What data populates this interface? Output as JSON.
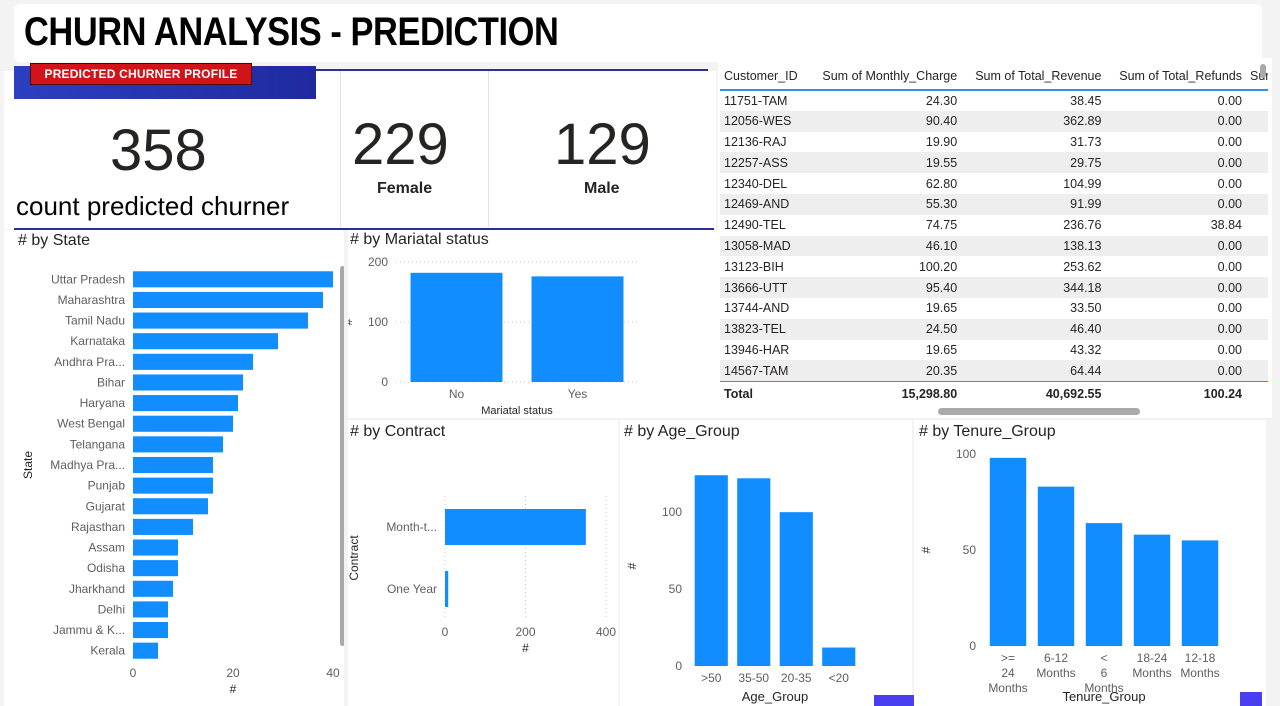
{
  "header": {
    "title": "CHURN ANALYSIS - PREDICTION",
    "badge": "PREDICTED CHURNER PROFILE"
  },
  "kpis": {
    "total": {
      "value": "358",
      "label": "count predicted churner"
    },
    "female": {
      "value": "229",
      "label": "Female"
    },
    "male": {
      "value": "129",
      "label": "Male"
    }
  },
  "table": {
    "columns": [
      "Customer_ID",
      "Sum of Monthly_Charge",
      "Sum of Total_Revenue",
      "Sum of Total_Refunds",
      "Sum"
    ],
    "rows": [
      [
        "11751-TAM",
        "24.30",
        "38.45",
        "0.00"
      ],
      [
        "12056-WES",
        "90.40",
        "362.89",
        "0.00"
      ],
      [
        "12136-RAJ",
        "19.90",
        "31.73",
        "0.00"
      ],
      [
        "12257-ASS",
        "19.55",
        "29.75",
        "0.00"
      ],
      [
        "12340-DEL",
        "62.80",
        "104.99",
        "0.00"
      ],
      [
        "12469-AND",
        "55.30",
        "91.99",
        "0.00"
      ],
      [
        "12490-TEL",
        "74.75",
        "236.76",
        "38.84"
      ],
      [
        "13058-MAD",
        "46.10",
        "138.13",
        "0.00"
      ],
      [
        "13123-BIH",
        "100.20",
        "253.62",
        "0.00"
      ],
      [
        "13666-UTT",
        "95.40",
        "344.18",
        "0.00"
      ],
      [
        "13744-AND",
        "19.65",
        "33.50",
        "0.00"
      ],
      [
        "13823-TEL",
        "24.50",
        "46.40",
        "0.00"
      ],
      [
        "13946-HAR",
        "19.65",
        "43.32",
        "0.00"
      ],
      [
        "14567-TAM",
        "20.35",
        "64.44",
        "0.00"
      ]
    ],
    "total": [
      "Total",
      "15,298.80",
      "40,692.55",
      "100.24"
    ]
  },
  "chart_data": [
    {
      "id": "state",
      "type": "bar",
      "orientation": "horizontal",
      "title": "# by State",
      "xlabel": "#",
      "ylabel": "State",
      "categories": [
        "Uttar Pradesh",
        "Maharashtra",
        "Tamil Nadu",
        "Karnataka",
        "Andhra Pra...",
        "Bihar",
        "Haryana",
        "West Bengal",
        "Telangana",
        "Madhya Pra...",
        "Punjab",
        "Gujarat",
        "Rajasthan",
        "Assam",
        "Odisha",
        "Jharkhand",
        "Delhi",
        "Jammu & K...",
        "Kerala"
      ],
      "values": [
        40,
        38,
        35,
        29,
        24,
        22,
        21,
        20,
        18,
        16,
        16,
        15,
        12,
        9,
        9,
        8,
        7,
        7,
        5
      ],
      "xlim": [
        0,
        40
      ],
      "xticks": [
        "0",
        "20",
        "40"
      ],
      "color": "#118DFF"
    },
    {
      "id": "marital",
      "type": "bar",
      "title": "# by Mariatal status",
      "xlabel": "Mariatal status",
      "ylabel": "#",
      "categories": [
        "No",
        "Yes"
      ],
      "values": [
        182,
        176
      ],
      "ylim": [
        0,
        200
      ],
      "yticks": [
        "0",
        "100",
        "200"
      ],
      "grid": true,
      "color": "#118DFF"
    },
    {
      "id": "contract",
      "type": "bar",
      "orientation": "horizontal",
      "title": "# by Contract",
      "xlabel": "#",
      "ylabel": "Contract",
      "categories": [
        "Month-t...",
        "One Year"
      ],
      "values": [
        350,
        8
      ],
      "xlim": [
        0,
        400
      ],
      "xticks": [
        "0",
        "200",
        "400"
      ],
      "grid": true,
      "color": "#118DFF"
    },
    {
      "id": "age",
      "type": "bar",
      "title": "# by Age_Group",
      "xlabel": "Age_Group",
      "ylabel": "#",
      "categories": [
        ">50",
        "35-50",
        "20-35",
        "<20"
      ],
      "values": [
        124,
        122,
        100,
        12
      ],
      "ylim": [
        0,
        130
      ],
      "yticks": [
        "0",
        "50",
        "100"
      ],
      "color": "#118DFF"
    },
    {
      "id": "tenure",
      "type": "bar",
      "title": "# by Tenure_Group",
      "xlabel": "Tenure_Group",
      "ylabel": "#",
      "categories": [
        ">= 24 Months",
        "6-12 Months",
        "< 6 Months",
        "18-24 Months",
        "12-18 Months"
      ],
      "values": [
        98,
        83,
        64,
        58,
        55
      ],
      "ylim": [
        0,
        100
      ],
      "yticks": [
        "0",
        "50",
        "100"
      ],
      "color": "#118DFF"
    }
  ]
}
